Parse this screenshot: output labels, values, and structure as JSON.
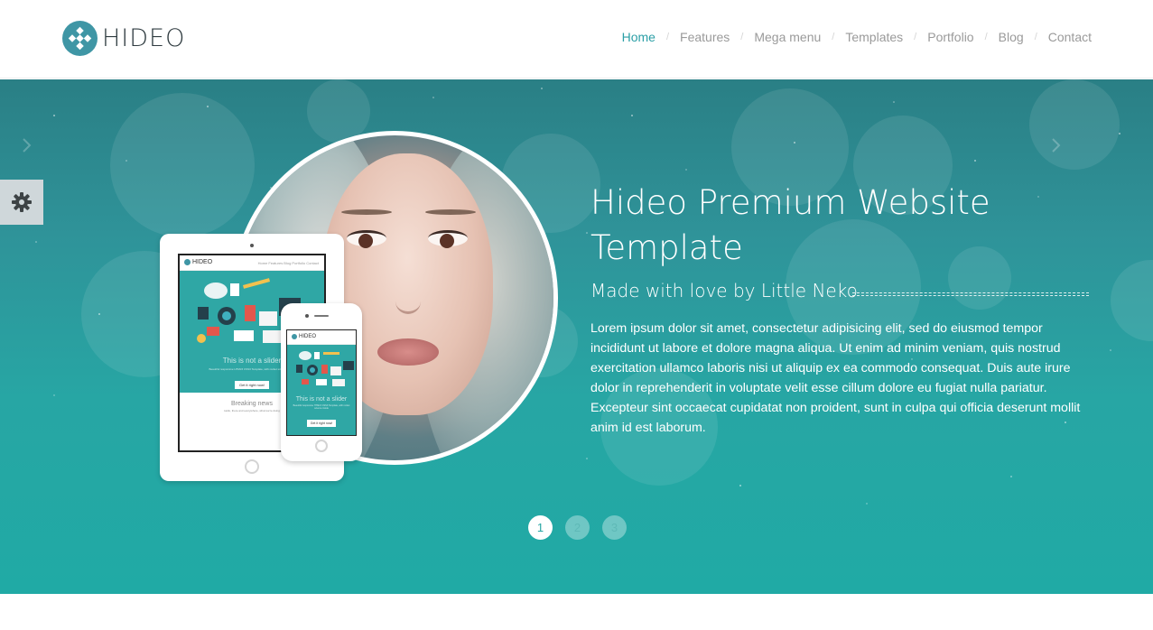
{
  "header": {
    "logo_text": "HIDEO",
    "nav": [
      {
        "label": "Home",
        "active": true
      },
      {
        "label": "Features",
        "active": false
      },
      {
        "label": "Mega menu",
        "active": false
      },
      {
        "label": "Templates",
        "active": false
      },
      {
        "label": "Portfolio",
        "active": false
      },
      {
        "label": "Blog",
        "active": false
      },
      {
        "label": "Contact",
        "active": false
      }
    ],
    "separator": "/"
  },
  "hero": {
    "title": "Hideo Premium Website Template",
    "subtitle": "Made with love by Little Neko",
    "body": "Lorem ipsum dolor sit amet, consectetur adipisicing elit, sed do eiusmod tempor incididunt ut labore et dolore magna aliqua. Ut enim ad minim veniam, quis nostrud exercitation ullamco laboris nisi ut aliquip ex ea commodo consequat. Duis aute irure dolor in reprehenderit in voluptate velit esse cillum dolore eu fugiat nulla pariatur. Excepteur sint occaecat cupidatat non proident, sunt in culpa qui officia deserunt mollit anim id est laborum.",
    "pager": [
      "1",
      "2",
      "3"
    ],
    "active_slide": 1
  },
  "mockup": {
    "logo_text": "HIDEO",
    "nav_text": "Home  Features  Blog  Portfolio  Contact",
    "caption": "This is not a slider",
    "small_text": "Beautiful responsive HTML5 CSS3 Template, with rocket science inside",
    "button": "Get it right now!",
    "section_title": "Breaking news",
    "section_text": "Hello, there and everywhere, what we're doing"
  },
  "colors": {
    "accent": "#2b9fa6",
    "hero_top": "#2a7f85",
    "hero_bottom": "#20aaa5",
    "logo_mark": "#3f96a5"
  },
  "icons": {
    "settings": "gear-icon",
    "prev": "chevron-left-icon",
    "next": "chevron-right-icon"
  }
}
